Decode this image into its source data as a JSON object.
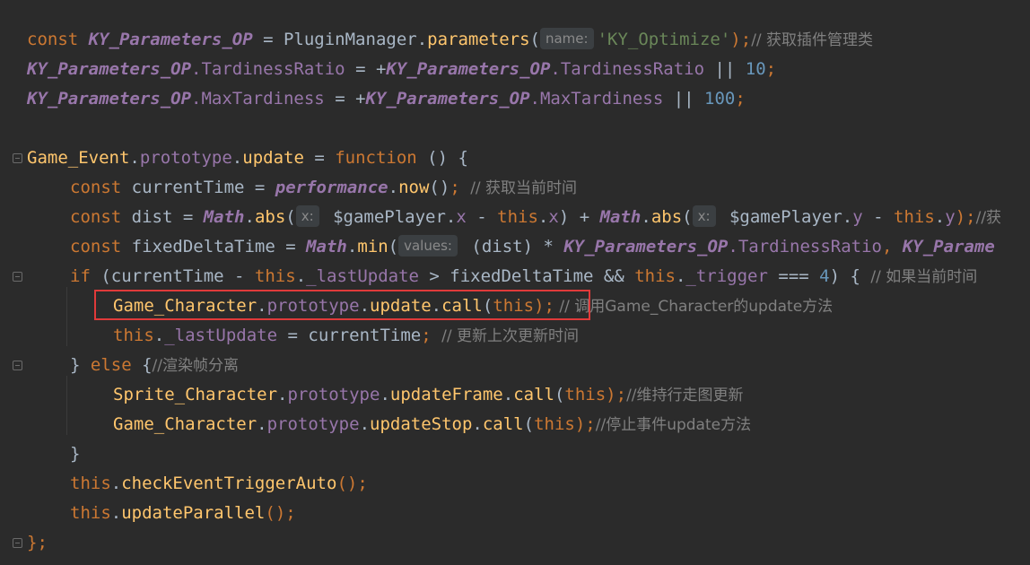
{
  "colors": {
    "background": "#2b2b2b",
    "keyword": "#cc7832",
    "global": "#9876aa",
    "function": "#ffc66d",
    "string": "#6a8759",
    "number": "#6897bb",
    "text": "#a9b7c6",
    "comment": "#808080",
    "highlight_border": "#e03a3a"
  },
  "code": {
    "l1": {
      "kw": "const ",
      "obj": "KY_Parameters_OP",
      "t1": " = PluginManager.",
      "fn": "parameters",
      "t2": "(",
      "hint": "name:",
      "str": "'KY_Optimize'",
      "t3": ");",
      "cmt": "// 获取插件管理类"
    },
    "l2": {
      "obj1": "KY_Parameters_OP",
      "p1": ".TardinessRatio",
      "t1": " = +",
      "obj2": "KY_Parameters_OP",
      "p2": ".TardinessRatio",
      "t2": " || ",
      "num": "10",
      "t3": ";"
    },
    "l3": {
      "obj1": "KY_Parameters_OP",
      "p1": ".MaxTardiness",
      "t1": " = +",
      "obj2": "KY_Parameters_OP",
      "p2": ".MaxTardiness",
      "t2": " || ",
      "num": "100",
      "t3": ";"
    },
    "l5": {
      "fn1": "Game_Event",
      "t1": ".",
      "p1": "prototype",
      "t2": ".",
      "fn2": "update",
      "t3": " = ",
      "kw": "function",
      "t4": " () {"
    },
    "l6": {
      "kw": "const ",
      "t1": "currentTime = ",
      "obj": "performance",
      "t2": ".",
      "fn": "now",
      "t3": "()",
      "t4": "; ",
      "cmt": "// 获取当前时间"
    },
    "l7": {
      "kw": "const ",
      "t1": "dist = ",
      "obj1": "Math",
      "t2": ".",
      "fn1": "abs",
      "t3": "(",
      "hint1": "x:",
      "t4": " $gamePlayer.",
      "p1": "x",
      "t5": " - ",
      "kw2": "this",
      "t6": ".",
      "p2": "x",
      "t7": ") + ",
      "obj2": "Math",
      "t8": ".",
      "fn2": "abs",
      "t9": "(",
      "hint2": "x:",
      "t10": " $gamePlayer.",
      "p3": "y",
      "t11": " - ",
      "kw3": "this",
      "t12": ".",
      "p4": "y",
      "t13": ");",
      "cmt": "//获"
    },
    "l8": {
      "kw": "const ",
      "t1": "fixedDeltaTime = ",
      "obj1": "Math",
      "t2": ".",
      "fn": "min",
      "t3": "(",
      "hint": "values:",
      "t4": " (dist) * ",
      "obj2": "KY_Parameters_OP",
      "p1": ".TardinessRatio",
      "t5": ", ",
      "obj3": "KY_Parame"
    },
    "l9": {
      "kw": "if",
      "t1": " (currentTime - ",
      "kw2": "this",
      "t2": ".",
      "p1": "_lastUpdate",
      "t3": " > fixedDeltaTime && ",
      "kw3": "this",
      "t4": ".",
      "p2": "_trigger",
      "t5": " === ",
      "num": "4",
      "t6": ") { ",
      "cmt": "// 如果当前时间"
    },
    "l10": {
      "fn1": "Game_Character",
      "t1": ".",
      "p1": "prototype",
      "t2": ".",
      "fn2": "update",
      "t3": ".",
      "fn3": "call",
      "t4": "(",
      "kw": "this",
      "t5": ");",
      "cmt": " // 调用Game_Character的update方法"
    },
    "l11": {
      "kw": "this",
      "t1": ".",
      "p1": "_lastUpdate",
      "t2": " = currentTime",
      "t3": "; ",
      "cmt": "// 更新上次更新时间"
    },
    "l12": {
      "t1": "} ",
      "kw": "else",
      "t2": " {",
      "cmt": "//渲染帧分离"
    },
    "l13": {
      "fn1": "Sprite_Character",
      "t1": ".",
      "p1": "prototype",
      "t2": ".",
      "fn2": "updateFrame",
      "t3": ".",
      "fn3": "call",
      "t4": "(",
      "kw": "this",
      "t5": ");",
      "cmt": "//维持行走图更新"
    },
    "l14": {
      "fn1": "Game_Character",
      "t1": ".",
      "p1": "prototype",
      "t2": ".",
      "fn2": "updateStop",
      "t3": ".",
      "fn3": "call",
      "t4": "(",
      "kw": "this",
      "t5": ");",
      "cmt": "//停止事件update方法"
    },
    "l15": {
      "t1": "}"
    },
    "l16": {
      "kw": "this",
      "t1": ".",
      "fn": "checkEventTriggerAuto",
      "t2": "();"
    },
    "l17": {
      "kw": "this",
      "t1": ".",
      "fn": "updateParallel",
      "t2": "();"
    },
    "l18": {
      "t1": "};"
    }
  }
}
